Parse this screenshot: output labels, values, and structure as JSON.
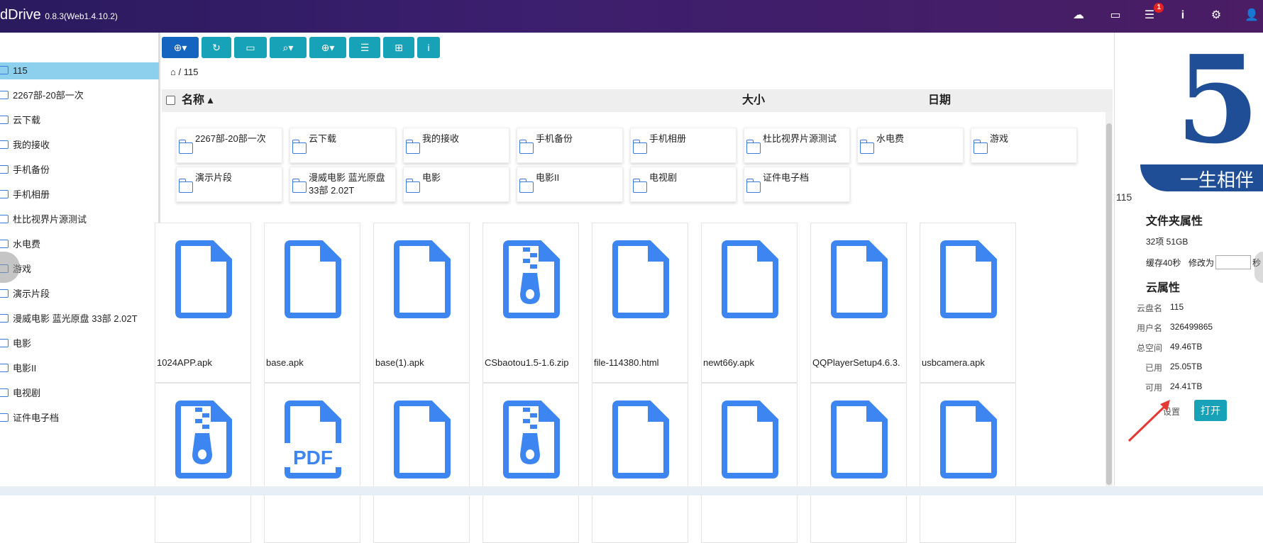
{
  "app": {
    "name": "dDrive",
    "version": "0.8.3(Web1.4.10.2)"
  },
  "topbar": {
    "notify_count": "1"
  },
  "tree": {
    "items": [
      "115",
      "2267部-20部一次",
      "云下载",
      "我的接收",
      "手机备份",
      "手机相册",
      "杜比视界片源测试",
      "水电费",
      "游戏",
      "演示片段",
      "漫威电影 蓝光原盘 33部 2.02T",
      "电影",
      "电影II",
      "电视剧",
      "证件电子档"
    ]
  },
  "breadcrumb": {
    "path": "115"
  },
  "columns": {
    "name": "名称",
    "size": "大小",
    "date": "日期"
  },
  "folders": [
    "2267部-20部一次",
    "云下载",
    "我的接收",
    "手机备份",
    "手机相册",
    "杜比视界片源测试",
    "水电费",
    "游戏",
    "演示片段",
    "漫威电影 蓝光原盘 33部 2.02T",
    "电影",
    "电影II",
    "电视剧",
    "证件电子档"
  ],
  "files": [
    {
      "name": "1024APP.apk",
      "icon": "file-icon"
    },
    {
      "name": "base.apk",
      "icon": "file-icon"
    },
    {
      "name": "base(1).apk",
      "icon": "file-icon"
    },
    {
      "name": "CSbaotou1.5-1.6.zip",
      "icon": "zip-icon"
    },
    {
      "name": "file-114380.html",
      "icon": "file-icon"
    },
    {
      "name": "newt66y.apk",
      "icon": "file-icon"
    },
    {
      "name": "QQPlayerSetup4.6.3.",
      "icon": "file-icon"
    },
    {
      "name": "usbcamera.apk",
      "icon": "file-icon"
    },
    {
      "name": "",
      "icon": "zip-icon"
    },
    {
      "name": "",
      "icon": "pdf-icon"
    },
    {
      "name": "",
      "icon": "file-icon"
    },
    {
      "name": "",
      "icon": "zip-icon"
    },
    {
      "name": "",
      "icon": "file-icon"
    },
    {
      "name": "",
      "icon": "file-icon"
    },
    {
      "name": "",
      "icon": "file-icon"
    },
    {
      "name": "",
      "icon": "file-icon"
    }
  ],
  "sidebar": {
    "logo_text": "一生相伴",
    "logo_number": "5",
    "drive_id": "115",
    "folder_props_title": "文件夹属性",
    "folder_summary": "32项  51GB",
    "cache_label": "缓存40秒",
    "modify_label": "修改为",
    "seconds_label": "秒",
    "cloud_props_title": "云属性",
    "props": [
      {
        "k": "云盘名",
        "v": "115"
      },
      {
        "k": "用户名",
        "v": "326499865"
      },
      {
        "k": "总空间",
        "v": "49.46TB"
      },
      {
        "k": "已用",
        "v": "25.05TB"
      },
      {
        "k": "可用",
        "v": "24.41TB"
      }
    ],
    "settings_label": "设置",
    "open_label": "打开"
  },
  "colors": {
    "accent": "#17a2b8",
    "primary": "#1565c0",
    "icon_blue": "#3d85f0",
    "topbar": "#2a1a5e"
  }
}
